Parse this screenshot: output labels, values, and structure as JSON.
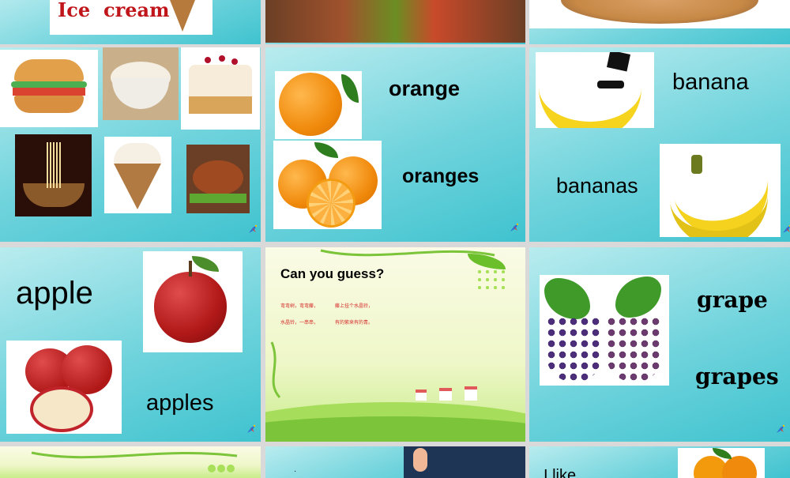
{
  "slides": {
    "ice_cream_title": {
      "text_line1": "Ice",
      "text_line2": "cream"
    },
    "orange": {
      "singular": "orange",
      "plural": "oranges"
    },
    "banana": {
      "singular": "banana",
      "plural": "bananas"
    },
    "apple": {
      "singular": "apple",
      "plural": "apples"
    },
    "guess": {
      "title": "Can you guess?",
      "riddle_line1_a": "弯弯树，弯弯藤，",
      "riddle_line1_b": "藤上挂个水晶铃，",
      "riddle_line2_a": "水晶铃，一串串，",
      "riddle_line2_b": "有的紫来有的青。"
    },
    "grape": {
      "singular": "grape",
      "plural": "grapes"
    },
    "bottom_right": {
      "text": "I like"
    }
  },
  "colors": {
    "slide_teal": "#6fd3dc",
    "title_red": "#c0161b",
    "riddle_red": "#d62828"
  },
  "icons": {
    "bird": "parrot-icon",
    "ice_cream": "ice-cream-cone-icon"
  }
}
